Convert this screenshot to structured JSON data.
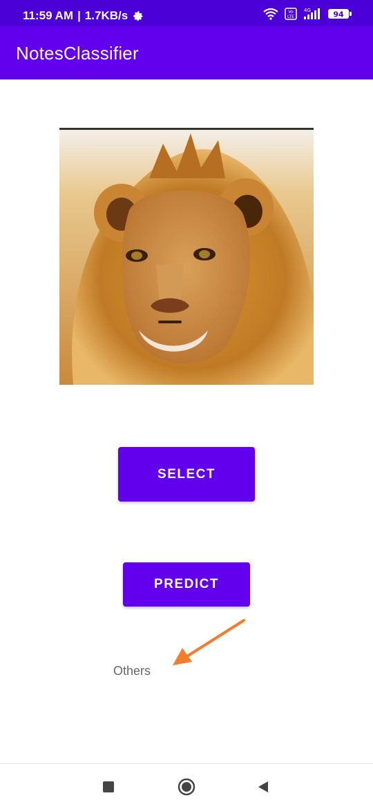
{
  "status_bar": {
    "time": "11:59 AM",
    "separator": "|",
    "speed": "1.7KB/s",
    "volte": "Vo LTE",
    "network": "4G",
    "battery": "94"
  },
  "app_bar": {
    "title": "NotesClassifier"
  },
  "main": {
    "image": {
      "subject": "lion"
    },
    "select_label": "SELECT",
    "predict_label": "PREDICT",
    "result_text": "Others"
  },
  "colors": {
    "status_bar": "#4a00d6",
    "primary": "#6200ee",
    "arrow": "#f57c2b"
  }
}
